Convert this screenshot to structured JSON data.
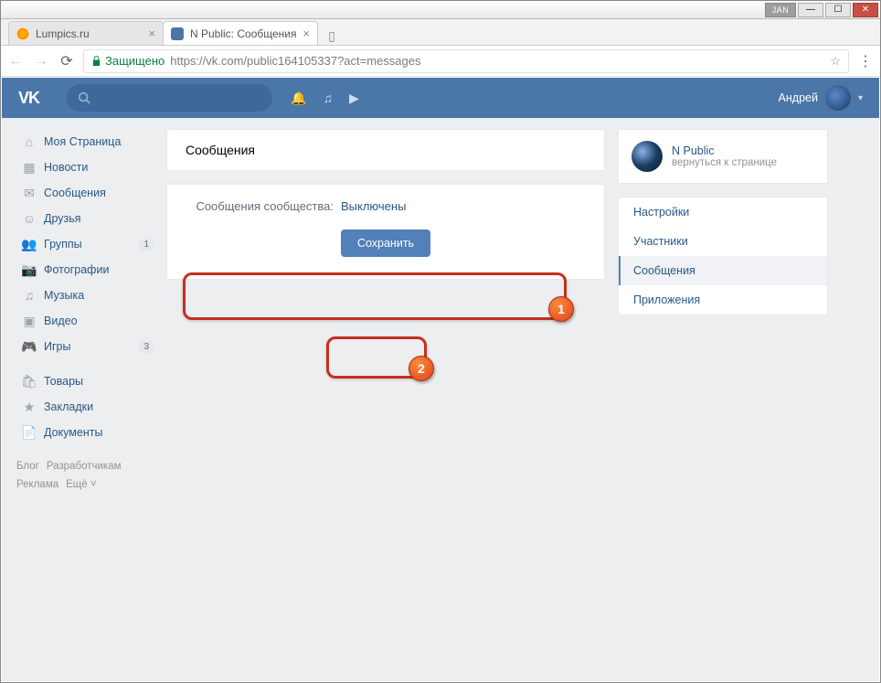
{
  "window": {
    "ext": "JAN"
  },
  "tabs": [
    {
      "title": "Lumpics.ru"
    },
    {
      "title": "N Public: Сообщения"
    }
  ],
  "addressbar": {
    "secure": "Защищено",
    "scheme": "https",
    "url_rest": "://vk.com/public164105337?act=messages"
  },
  "header": {
    "logo": "VK",
    "user": "Андрей"
  },
  "leftnav": {
    "items": [
      {
        "label": "Моя Страница",
        "icon": "⌂"
      },
      {
        "label": "Новости",
        "icon": "▦"
      },
      {
        "label": "Сообщения",
        "icon": "✉",
        "current": true
      },
      {
        "label": "Друзья",
        "icon": "☺"
      },
      {
        "label": "Группы",
        "icon": "👥",
        "badge": "1"
      },
      {
        "label": "Фотографии",
        "icon": "📷"
      },
      {
        "label": "Музыка",
        "icon": "♫"
      },
      {
        "label": "Видео",
        "icon": "▣"
      },
      {
        "label": "Игры",
        "icon": "🎮",
        "badge": "3"
      }
    ],
    "items2": [
      {
        "label": "Товары",
        "icon": "🛍"
      },
      {
        "label": "Закладки",
        "icon": "★"
      },
      {
        "label": "Документы",
        "icon": "📄"
      }
    ],
    "footer": [
      "Блог",
      "Разработчикам",
      "Реклама",
      "Ещё ˅"
    ]
  },
  "main": {
    "heading": "Сообщения",
    "row_label": "Сообщения сообщества:",
    "row_value": "Выключены",
    "save": "Сохранить"
  },
  "right": {
    "title": "N Public",
    "subtitle": "вернуться к странице",
    "menu": [
      "Настройки",
      "Участники",
      "Сообщения",
      "Приложения"
    ],
    "selected": 2
  },
  "marks": {
    "one": "1",
    "two": "2"
  }
}
